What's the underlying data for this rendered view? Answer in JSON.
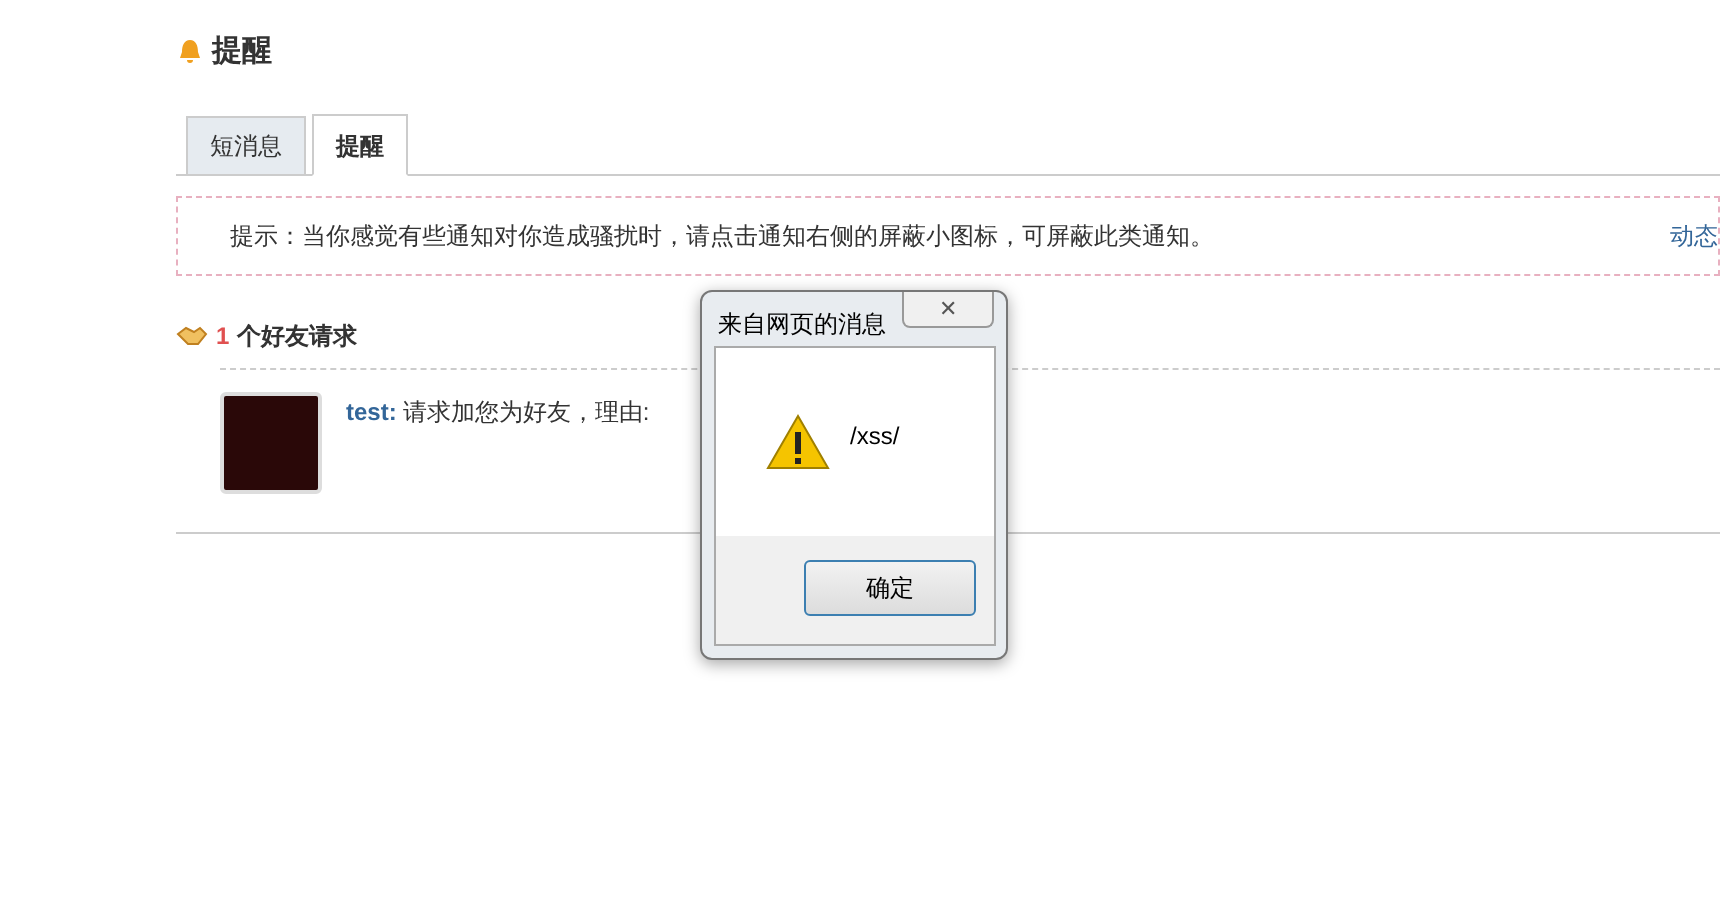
{
  "page_title": "提醒",
  "tabs": [
    {
      "label": "短消息",
      "selected": false
    },
    {
      "label": "提醒",
      "selected": true
    }
  ],
  "tip": {
    "text": "提示：当你感觉有些通知对你造成骚扰时，请点击通知右侧的屏蔽小图标，可屏蔽此类通知。",
    "link": "动态"
  },
  "friend_requests": {
    "count": "1",
    "label": "个好友请求",
    "items": [
      {
        "user": "test:",
        "message": "请求加您为好友，理由:"
      }
    ]
  },
  "dialog": {
    "title": "来自网页的消息",
    "close": "✕",
    "message": "/xss/",
    "button": "确定"
  }
}
